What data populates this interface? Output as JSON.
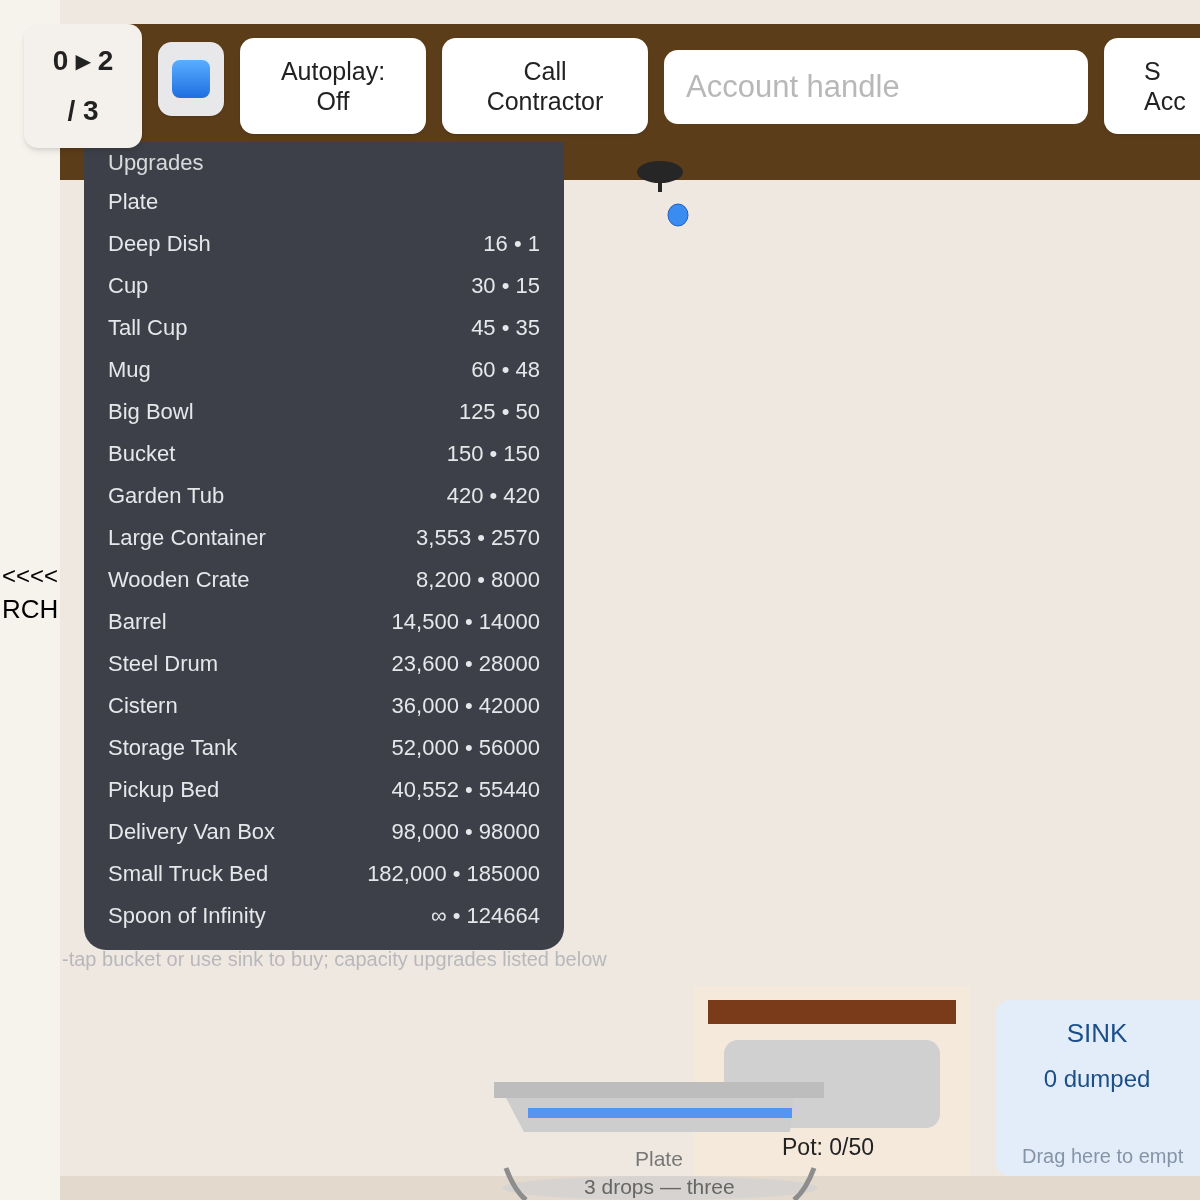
{
  "counter": {
    "value": "0 ▸ 2",
    "total": "/ 3"
  },
  "toolbar": {
    "buttons": [
      {
        "label": "Autoplay:\nOff"
      },
      {
        "label": "Call\nContractor"
      }
    ],
    "handle_field": {
      "placeholder": "Account handle"
    },
    "cut_button": {
      "label": "S\nAcc"
    }
  },
  "side_label": {
    "arrows": "<<<<",
    "word": "RCH"
  },
  "upgrades": {
    "title": "Upgrades",
    "items": [
      {
        "name": "Plate",
        "value": ""
      },
      {
        "name": "Deep Dish",
        "value": "16 • 1"
      },
      {
        "name": "Cup",
        "value": "30 • 15"
      },
      {
        "name": "Tall Cup",
        "value": "45 • 35"
      },
      {
        "name": "Mug",
        "value": "60 • 48"
      },
      {
        "name": "Big Bowl",
        "value": "125 • 50"
      },
      {
        "name": "Bucket",
        "value": "150 • 150"
      },
      {
        "name": "Garden Tub",
        "value": "420 • 420"
      },
      {
        "name": "Large Container",
        "value": "3,553 • 2570"
      },
      {
        "name": "Wooden Crate",
        "value": "8,200 • 8000"
      },
      {
        "name": "Barrel",
        "value": "14,500 • 14000"
      },
      {
        "name": "Steel Drum",
        "value": "23,600 • 28000"
      },
      {
        "name": "Cistern",
        "value": "36,000 • 42000"
      },
      {
        "name": "Storage Tank",
        "value": "52,000 • 56000"
      },
      {
        "name": "Pickup Bed",
        "value": "40,552 • 55440"
      },
      {
        "name": "Delivery Van Box",
        "value": "98,000 • 98000"
      },
      {
        "name": "Small Truck Bed",
        "value": "182,000 • 185000"
      },
      {
        "name": "Spoon of Infinity",
        "value": "∞ • 124664"
      }
    ],
    "hint": "-tap bucket or use sink to buy; capacity upgrades listed below"
  },
  "container": {
    "name": "Plate",
    "drops": "3 drops — three"
  },
  "pot": {
    "label": "Pot: 0/50"
  },
  "sink": {
    "title": "SINK",
    "count": "0 dumped",
    "hint": "Drag here to empt"
  }
}
